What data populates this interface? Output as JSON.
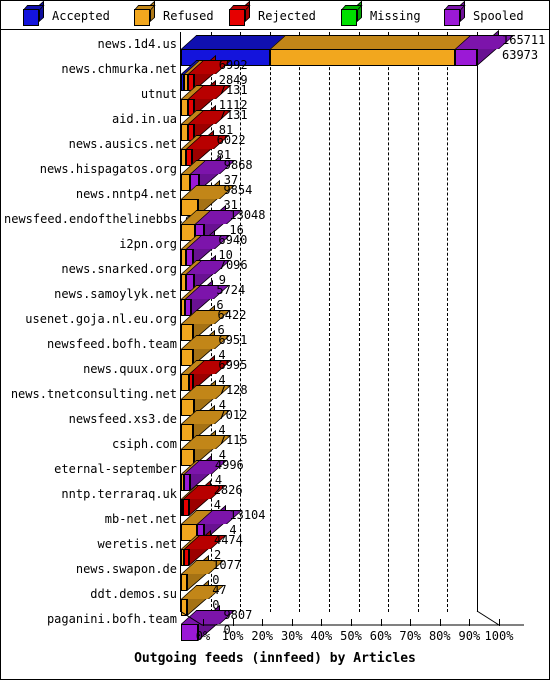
{
  "chart_data": {
    "type": "bar",
    "orientation": "horizontal",
    "subtype": "stacked-percent-3d",
    "title": "Outgoing feeds (innfeed) by Articles",
    "xlabel": "",
    "ylabel": "",
    "xlim": [
      0,
      100
    ],
    "x_unit": "%",
    "grid": true,
    "legend_position": "top",
    "tick_labels": [
      "0%",
      "10%",
      "20%",
      "30%",
      "40%",
      "50%",
      "60%",
      "70%",
      "80%",
      "90%",
      "100%"
    ],
    "tick_values": [
      0,
      10,
      20,
      30,
      40,
      50,
      60,
      70,
      80,
      90,
      100
    ],
    "legend": [
      {
        "name": "Accepted",
        "color": "#1414dc"
      },
      {
        "name": "Refused",
        "color": "#f2a71e"
      },
      {
        "name": "Rejected",
        "color": "#e60000"
      },
      {
        "name": "Missing",
        "color": "#00e000"
      },
      {
        "name": "Spooled",
        "color": "#9b19d6"
      }
    ],
    "series": [
      {
        "name": "Accepted",
        "color": "#1414dc"
      },
      {
        "name": "Refused",
        "color": "#f2a71e"
      },
      {
        "name": "Rejected",
        "color": "#e60000"
      },
      {
        "name": "Missing",
        "color": "#00e000"
      },
      {
        "name": "Spooled",
        "color": "#9b19d6"
      }
    ],
    "categories": [
      "news.1d4.us",
      "news.chmurka.net",
      "utnut",
      "aid.in.ua",
      "news.ausics.net",
      "news.hispagatos.org",
      "news.nntp4.net",
      "newsfeed.endofthelinebbs.com",
      "i2pn.org",
      "news.snarked.org",
      "news.samoylyk.net",
      "usenet.goja.nl.eu.org",
      "newsfeed.bofh.team",
      "news.quux.org",
      "news.tnetconsulting.net",
      "newsfeed.xs3.de",
      "csiph.com",
      "eternal-september",
      "nntp.terraraq.uk",
      "mb-net.net",
      "weretis.net",
      "news.swapon.de",
      "ddt.demos.su",
      "paganini.bofh.team"
    ],
    "rows": [
      {
        "category": "news.1d4.us",
        "value_top": "165711",
        "value_bottom": "63973",
        "total_pct": 100.0,
        "segments": [
          {
            "series": "Accepted",
            "pct": 30.0
          },
          {
            "series": "Refused",
            "pct": 62.5
          },
          {
            "series": "Spooled",
            "pct": 7.5
          }
        ]
      },
      {
        "category": "news.chmurka.net",
        "value_top": "6992",
        "value_bottom": "2849",
        "total_pct": 4.3,
        "segments": [
          {
            "series": "Accepted",
            "pct": 1.1
          },
          {
            "series": "Refused",
            "pct": 1.2
          },
          {
            "series": "Rejected",
            "pct": 2.0
          }
        ]
      },
      {
        "category": "utnut",
        "value_top": "7131",
        "value_bottom": "1112",
        "total_pct": 4.3,
        "segments": [
          {
            "series": "Refused",
            "pct": 2.2
          },
          {
            "series": "Rejected",
            "pct": 2.1
          }
        ]
      },
      {
        "category": "aid.in.ua",
        "value_top": "7131",
        "value_bottom": "81",
        "total_pct": 4.3,
        "segments": [
          {
            "series": "Refused",
            "pct": 2.2
          },
          {
            "series": "Rejected",
            "pct": 2.1
          }
        ]
      },
      {
        "category": "news.ausics.net",
        "value_top": "6022",
        "value_bottom": "81",
        "total_pct": 3.6,
        "segments": [
          {
            "series": "Refused",
            "pct": 1.6
          },
          {
            "series": "Rejected",
            "pct": 2.0
          }
        ]
      },
      {
        "category": "news.hispagatos.org",
        "value_top": "9868",
        "value_bottom": "37",
        "total_pct": 6.0,
        "segments": [
          {
            "series": "Refused",
            "pct": 3.2
          },
          {
            "series": "Spooled",
            "pct": 2.8
          }
        ]
      },
      {
        "category": "news.nntp4.net",
        "value_top": "9854",
        "value_bottom": "31",
        "total_pct": 5.9,
        "segments": [
          {
            "series": "Refused",
            "pct": 5.9
          }
        ]
      },
      {
        "category": "newsfeed.endofthelinebbs.com",
        "value_top": "13048",
        "value_bottom": "16",
        "total_pct": 7.9,
        "segments": [
          {
            "series": "Refused",
            "pct": 4.6
          },
          {
            "series": "Spooled",
            "pct": 3.3
          }
        ]
      },
      {
        "category": "i2pn.org",
        "value_top": "6940",
        "value_bottom": "10",
        "total_pct": 4.2,
        "segments": [
          {
            "series": "Refused",
            "pct": 1.8
          },
          {
            "series": "Spooled",
            "pct": 2.4
          }
        ]
      },
      {
        "category": "news.snarked.org",
        "value_top": "7096",
        "value_bottom": "9",
        "total_pct": 4.3,
        "segments": [
          {
            "series": "Refused",
            "pct": 1.8
          },
          {
            "series": "Spooled",
            "pct": 2.5
          }
        ]
      },
      {
        "category": "news.samoylyk.net",
        "value_top": "5724",
        "value_bottom": "6",
        "total_pct": 3.5,
        "segments": [
          {
            "series": "Refused",
            "pct": 1.3
          },
          {
            "series": "Spooled",
            "pct": 2.2
          }
        ]
      },
      {
        "category": "usenet.goja.nl.eu.org",
        "value_top": "6422",
        "value_bottom": "6",
        "total_pct": 3.9,
        "segments": [
          {
            "series": "Refused",
            "pct": 3.9
          }
        ]
      },
      {
        "category": "newsfeed.bofh.team",
        "value_top": "6951",
        "value_bottom": "4",
        "total_pct": 4.2,
        "segments": [
          {
            "series": "Refused",
            "pct": 4.2
          }
        ]
      },
      {
        "category": "news.quux.org",
        "value_top": "6995",
        "value_bottom": "4",
        "total_pct": 4.2,
        "segments": [
          {
            "series": "Refused",
            "pct": 2.6
          },
          {
            "series": "Rejected",
            "pct": 1.6
          }
        ]
      },
      {
        "category": "news.tnetconsulting.net",
        "value_top": "7128",
        "value_bottom": "4",
        "total_pct": 4.3,
        "segments": [
          {
            "series": "Refused",
            "pct": 4.3
          }
        ]
      },
      {
        "category": "newsfeed.xs3.de",
        "value_top": "7012",
        "value_bottom": "4",
        "total_pct": 4.2,
        "segments": [
          {
            "series": "Refused",
            "pct": 4.2
          }
        ]
      },
      {
        "category": "csiph.com",
        "value_top": "7115",
        "value_bottom": "4",
        "total_pct": 4.3,
        "segments": [
          {
            "series": "Refused",
            "pct": 4.3
          }
        ]
      },
      {
        "category": "eternal-september",
        "value_top": "4996",
        "value_bottom": "4",
        "total_pct": 3.0,
        "segments": [
          {
            "series": "Refused",
            "pct": 1.0
          },
          {
            "series": "Spooled",
            "pct": 2.0
          }
        ]
      },
      {
        "category": "nntp.terraraq.uk",
        "value_top": "2826",
        "value_bottom": "4",
        "total_pct": 2.6,
        "segments": [
          {
            "series": "Refused",
            "pct": 0.6
          },
          {
            "series": "Rejected",
            "pct": 2.0
          }
        ]
      },
      {
        "category": "mb-net.net",
        "value_top": "13104",
        "value_bottom": "4",
        "total_pct": 7.9,
        "segments": [
          {
            "series": "Refused",
            "pct": 5.3
          },
          {
            "series": "Spooled",
            "pct": 2.6
          }
        ]
      },
      {
        "category": "weretis.net",
        "value_top": "4474",
        "value_bottom": "2",
        "total_pct": 2.7,
        "segments": [
          {
            "series": "Refused",
            "pct": 1.0
          },
          {
            "series": "Rejected",
            "pct": 1.7
          }
        ]
      },
      {
        "category": "news.swapon.de",
        "value_top": "1077",
        "value_bottom": "0",
        "total_pct": 2.1,
        "segments": [
          {
            "series": "Refused",
            "pct": 2.1
          }
        ]
      },
      {
        "category": "ddt.demos.su",
        "value_top": "47",
        "value_bottom": "0",
        "total_pct": 2.1,
        "segments": [
          {
            "series": "Refused",
            "pct": 2.1
          }
        ]
      },
      {
        "category": "paganini.bofh.team",
        "value_top": "9807",
        "value_bottom": "0",
        "total_pct": 5.9,
        "segments": [
          {
            "series": "Spooled",
            "pct": 5.9
          }
        ]
      }
    ]
  }
}
